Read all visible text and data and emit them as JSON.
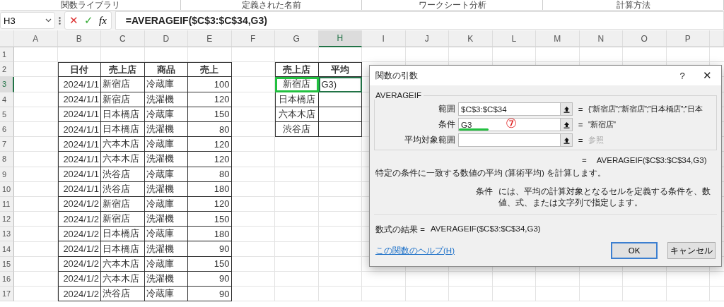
{
  "ribbon_groups": [
    "関数ライブラリ",
    "定義された名前",
    "ワークシート分析",
    "計算方法"
  ],
  "formula_bar": {
    "name_box": "H3",
    "cancel": "✕",
    "enter": "✓",
    "fx": "fx",
    "formula": "=AVERAGEIF($C$3:$C$34,G3)"
  },
  "columns": [
    {
      "letter": "A",
      "selected": false
    },
    {
      "letter": "B",
      "selected": false
    },
    {
      "letter": "C",
      "selected": false
    },
    {
      "letter": "D",
      "selected": false
    },
    {
      "letter": "E",
      "selected": false
    },
    {
      "letter": "F",
      "selected": false
    },
    {
      "letter": "G",
      "selected": false
    },
    {
      "letter": "H",
      "selected": true
    },
    {
      "letter": "I",
      "selected": false
    },
    {
      "letter": "J",
      "selected": false
    },
    {
      "letter": "K",
      "selected": false
    },
    {
      "letter": "L",
      "selected": false
    },
    {
      "letter": "M",
      "selected": false
    },
    {
      "letter": "N",
      "selected": false
    },
    {
      "letter": "O",
      "selected": false
    },
    {
      "letter": "P",
      "selected": false
    }
  ],
  "rows": [
    {
      "number": "1",
      "selected": false
    },
    {
      "number": "2",
      "selected": false
    },
    {
      "number": "3",
      "selected": true
    },
    {
      "number": "4",
      "selected": false
    },
    {
      "number": "5",
      "selected": false
    },
    {
      "number": "6",
      "selected": false
    },
    {
      "number": "7",
      "selected": false
    },
    {
      "number": "8",
      "selected": false
    },
    {
      "number": "9",
      "selected": false
    },
    {
      "number": "10",
      "selected": false
    },
    {
      "number": "11",
      "selected": false
    },
    {
      "number": "12",
      "selected": false
    },
    {
      "number": "13",
      "selected": false
    },
    {
      "number": "14",
      "selected": false
    },
    {
      "number": "15",
      "selected": false
    },
    {
      "number": "16",
      "selected": false
    },
    {
      "number": "17",
      "selected": false
    }
  ],
  "sales_table": {
    "headers": [
      "日付",
      "売上店",
      "商品",
      "売上"
    ],
    "rows": [
      [
        "2024/1/1",
        "新宿店",
        "冷蔵庫",
        "100"
      ],
      [
        "2024/1/1",
        "新宿店",
        "洗濯機",
        "120"
      ],
      [
        "2024/1/1",
        "日本橋店",
        "冷蔵庫",
        "150"
      ],
      [
        "2024/1/1",
        "日本橋店",
        "洗濯機",
        "80"
      ],
      [
        "2024/1/1",
        "六本木店",
        "冷蔵庫",
        "120"
      ],
      [
        "2024/1/1",
        "六本木店",
        "洗濯機",
        "120"
      ],
      [
        "2024/1/1",
        "渋谷店",
        "冷蔵庫",
        "80"
      ],
      [
        "2024/1/1",
        "渋谷店",
        "洗濯機",
        "180"
      ],
      [
        "2024/1/2",
        "新宿店",
        "冷蔵庫",
        "120"
      ],
      [
        "2024/1/2",
        "新宿店",
        "洗濯機",
        "150"
      ],
      [
        "2024/1/2",
        "日本橋店",
        "冷蔵庫",
        "180"
      ],
      [
        "2024/1/2",
        "日本橋店",
        "洗濯機",
        "90"
      ],
      [
        "2024/1/2",
        "六本木店",
        "冷蔵庫",
        "150"
      ],
      [
        "2024/1/2",
        "六本木店",
        "洗濯機",
        "90"
      ],
      [
        "2024/1/2",
        "渋谷店",
        "冷蔵庫",
        "90"
      ]
    ]
  },
  "summary_table": {
    "headers": [
      "売上店",
      "平均"
    ],
    "rows": [
      {
        "store": "新宿店",
        "referenced": true,
        "average": "G3)",
        "selected": true
      },
      {
        "store": "日本橋店",
        "referenced": false,
        "selected": false
      },
      {
        "store": "六本木店",
        "referenced": false,
        "selected": false
      },
      {
        "store": "渋谷店",
        "referenced": false,
        "selected": false
      }
    ]
  },
  "dialog": {
    "title": "関数の引数",
    "help": "?",
    "close": "✕",
    "function_name": "AVERAGEIF",
    "arguments": [
      {
        "label": "範囲",
        "value": "$C$3:$C$34",
        "equals": "=",
        "result": "{\"新宿店\";\"新宿店\";\"日本橋店\";\"日本",
        "result_disabled": false,
        "underlined": false
      },
      {
        "label": "条件",
        "value": "G3",
        "equals": "=",
        "result": "\"新宿店\"",
        "result_disabled": false,
        "underlined": true,
        "annotation": "⑦"
      },
      {
        "label": "平均対象範囲",
        "equals": "=",
        "result": "参照",
        "result_disabled": true,
        "underlined": false
      }
    ],
    "function_result_equals": "=",
    "function_result": "AVERAGEIF($C$3:$C$34,G3)",
    "description": "特定の条件に一致する数値の平均 (算術平均) を計算します。",
    "argument_help_label": "条件",
    "argument_help": "には、平均の計算対象となるセルを定義する条件を、数値、式、または文字列で指定します。",
    "formula_result_label": "数式の結果 =",
    "formula_result": "AVERAGEIF($C$3:$C$34,G3)",
    "help_link": "この関数のヘルプ(H)",
    "buttons": [
      {
        "label": "OK",
        "default": true
      },
      {
        "label": "キャンセル",
        "default": false
      }
    ]
  }
}
